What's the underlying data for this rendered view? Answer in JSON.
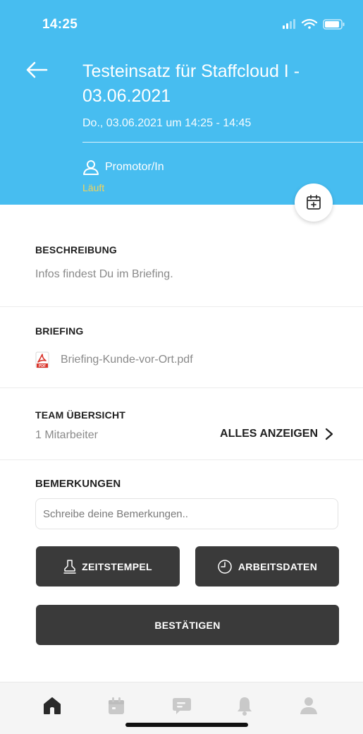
{
  "status_bar": {
    "time": "14:25"
  },
  "header": {
    "title": "Testeinsatz für Staffcloud I - 03.06.2021",
    "subtitle": "Do., 03.06.2021 um 14:25 - 14:45",
    "role": "Promotor/In",
    "status": "Läuft",
    "status_color": "#f2d35a",
    "background_color": "#47bdf0"
  },
  "description": {
    "title": "BESCHREIBUNG",
    "text": "Infos findest Du im Briefing."
  },
  "briefing": {
    "title": "BRIEFING",
    "file_name": "Briefing-Kunde-vor-Ort.pdf",
    "file_icon": "pdf-icon"
  },
  "team": {
    "title": "TEAM ÜBERSICHT",
    "count": "1 Mitarbeiter",
    "show_all": "ALLES ANZEIGEN"
  },
  "remarks": {
    "title": "BEMERKUNGEN",
    "placeholder": "Schreibe deine Bemerkungen.."
  },
  "actions": {
    "timestamp": "ZEITSTEMPEL",
    "workdata": "ARBEITSDATEN",
    "confirm": "BESTÄTIGEN",
    "button_color": "#3a3a3a"
  },
  "tabbar": {
    "items": [
      "home-icon",
      "calendar-icon",
      "chat-icon",
      "bell-icon",
      "profile-icon"
    ],
    "active": "home-icon"
  }
}
